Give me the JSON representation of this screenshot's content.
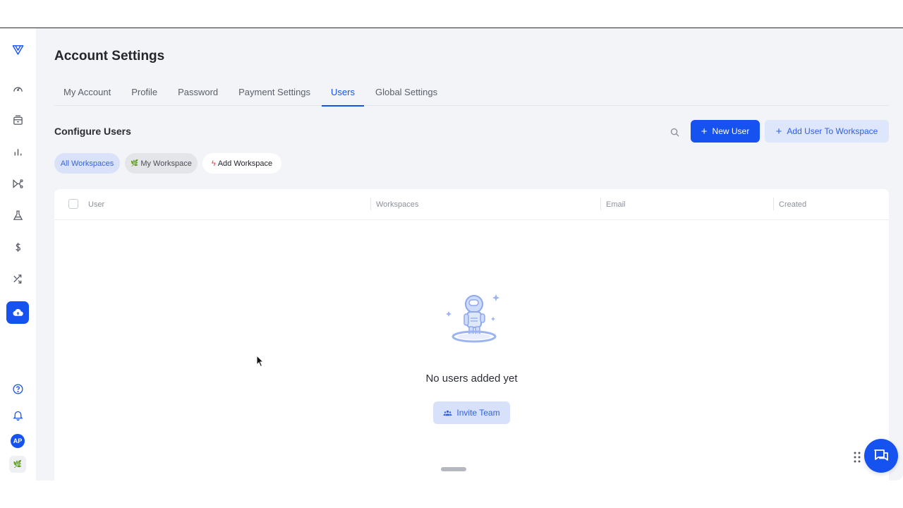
{
  "page": {
    "title": "Account Settings"
  },
  "tabs": [
    {
      "label": "My Account",
      "active": false
    },
    {
      "label": "Profile",
      "active": false
    },
    {
      "label": "Password",
      "active": false
    },
    {
      "label": "Payment Settings",
      "active": false
    },
    {
      "label": "Users",
      "active": true
    },
    {
      "label": "Global Settings",
      "active": false
    }
  ],
  "section": {
    "title": "Configure Users"
  },
  "toolbar": {
    "new_user_label": "New User",
    "add_user_to_workspace_label": "Add User To Workspace"
  },
  "workspace_filters": {
    "all_label": "All Workspaces",
    "my_label": "My Workspace",
    "add_label": "Add Workspace"
  },
  "table": {
    "columns": [
      "User",
      "Workspaces",
      "Email",
      "Created"
    ]
  },
  "empty_state": {
    "message": "No users added yet",
    "invite_label": "Invite Team"
  },
  "sidebar": {
    "avatar_initials": "AP",
    "items": [
      {
        "icon": "dashboard-gauge-icon"
      },
      {
        "icon": "archive-box-icon"
      },
      {
        "icon": "bar-chart-icon"
      },
      {
        "icon": "workflow-icon"
      },
      {
        "icon": "flask-icon"
      },
      {
        "icon": "dollar-icon"
      },
      {
        "icon": "shuffle-icon"
      },
      {
        "icon": "cloud-upload-icon",
        "active": true
      }
    ]
  },
  "colors": {
    "accent": "#1652f0",
    "accent_light": "#dde6fb",
    "background": "#f3f4f7"
  }
}
